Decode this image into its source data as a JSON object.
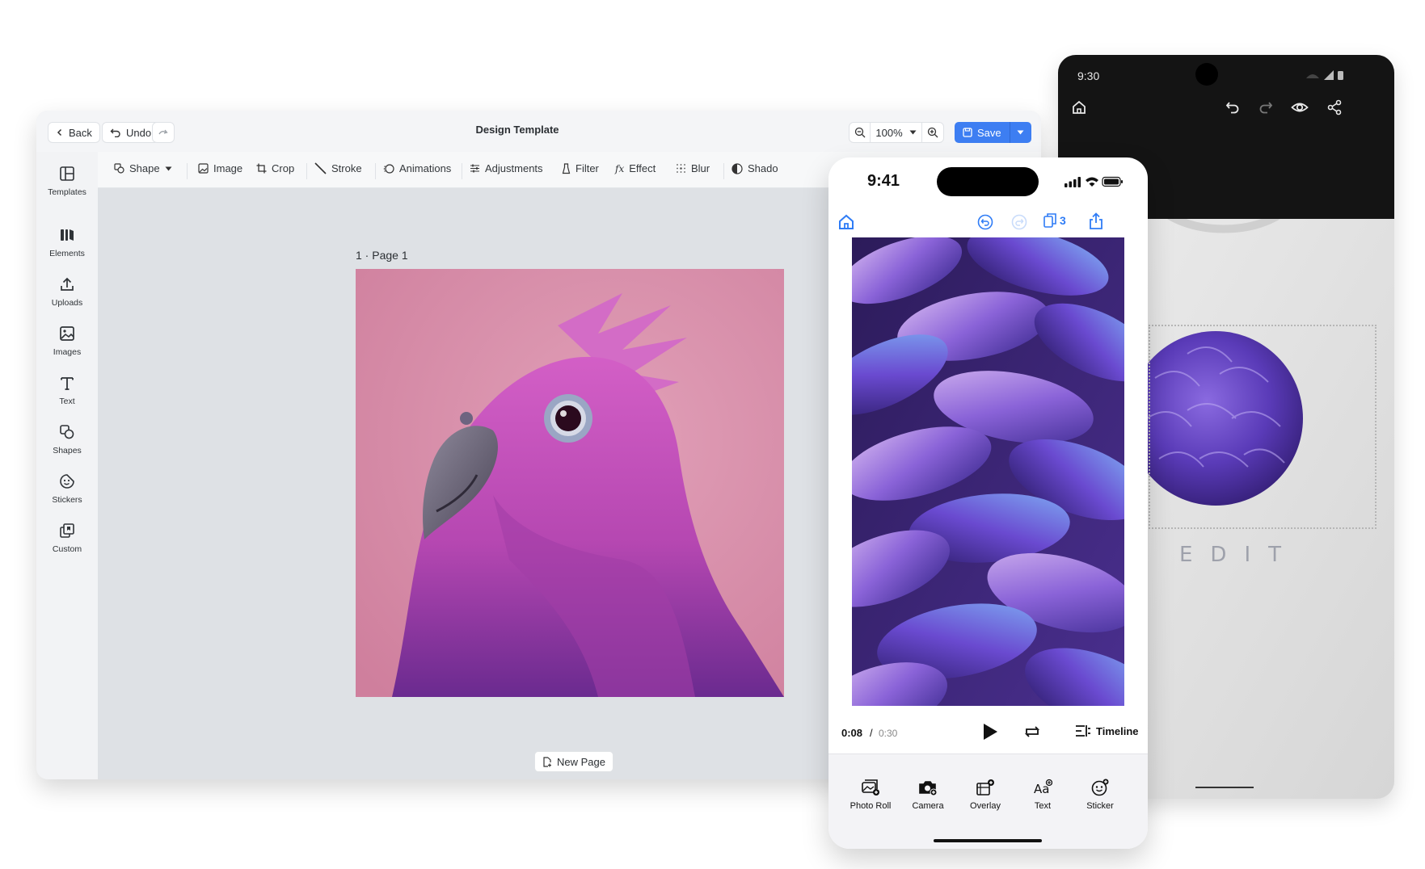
{
  "desktop": {
    "title": "Design Template",
    "back_label": "Back",
    "undo_label": "Undo",
    "zoom_value": "100%",
    "save_label": "Save",
    "sidebar": [
      {
        "label": "Templates",
        "icon": "templates-icon"
      },
      {
        "label": "Elements",
        "icon": "elements-icon"
      },
      {
        "label": "Uploads",
        "icon": "upload-icon"
      },
      {
        "label": "Images",
        "icon": "image-icon"
      },
      {
        "label": "Text",
        "icon": "text-icon"
      },
      {
        "label": "Shapes",
        "icon": "shapes-icon"
      },
      {
        "label": "Stickers",
        "icon": "sticker-icon"
      },
      {
        "label": "Custom",
        "icon": "custom-icon"
      }
    ],
    "tools": {
      "shape": "Shape",
      "image": "Image",
      "crop": "Crop",
      "stroke": "Stroke",
      "animations": "Animations",
      "adjustments": "Adjustments",
      "filter": "Filter",
      "effect": "Effect",
      "blur": "Blur",
      "shadow": "Shado"
    },
    "page_label": "1 · Page 1",
    "new_page_label": "New Page",
    "accent_color": "#3d7ef2"
  },
  "android": {
    "time": "9:30",
    "shirt_text": "EDIT"
  },
  "iphone": {
    "time": "9:41",
    "pages_count": "3",
    "current_time": "0:08",
    "separator": "/",
    "total_time": "0:30",
    "timeline_label": "Timeline",
    "tabs": [
      {
        "label": "Photo Roll",
        "icon": "photo-roll-icon"
      },
      {
        "label": "Camera",
        "icon": "camera-icon"
      },
      {
        "label": "Overlay",
        "icon": "overlay-icon"
      },
      {
        "label": "Text",
        "icon": "text-icon"
      },
      {
        "label": "Sticker",
        "icon": "sticker-icon"
      }
    ],
    "accent_color": "#2f7cf6"
  }
}
